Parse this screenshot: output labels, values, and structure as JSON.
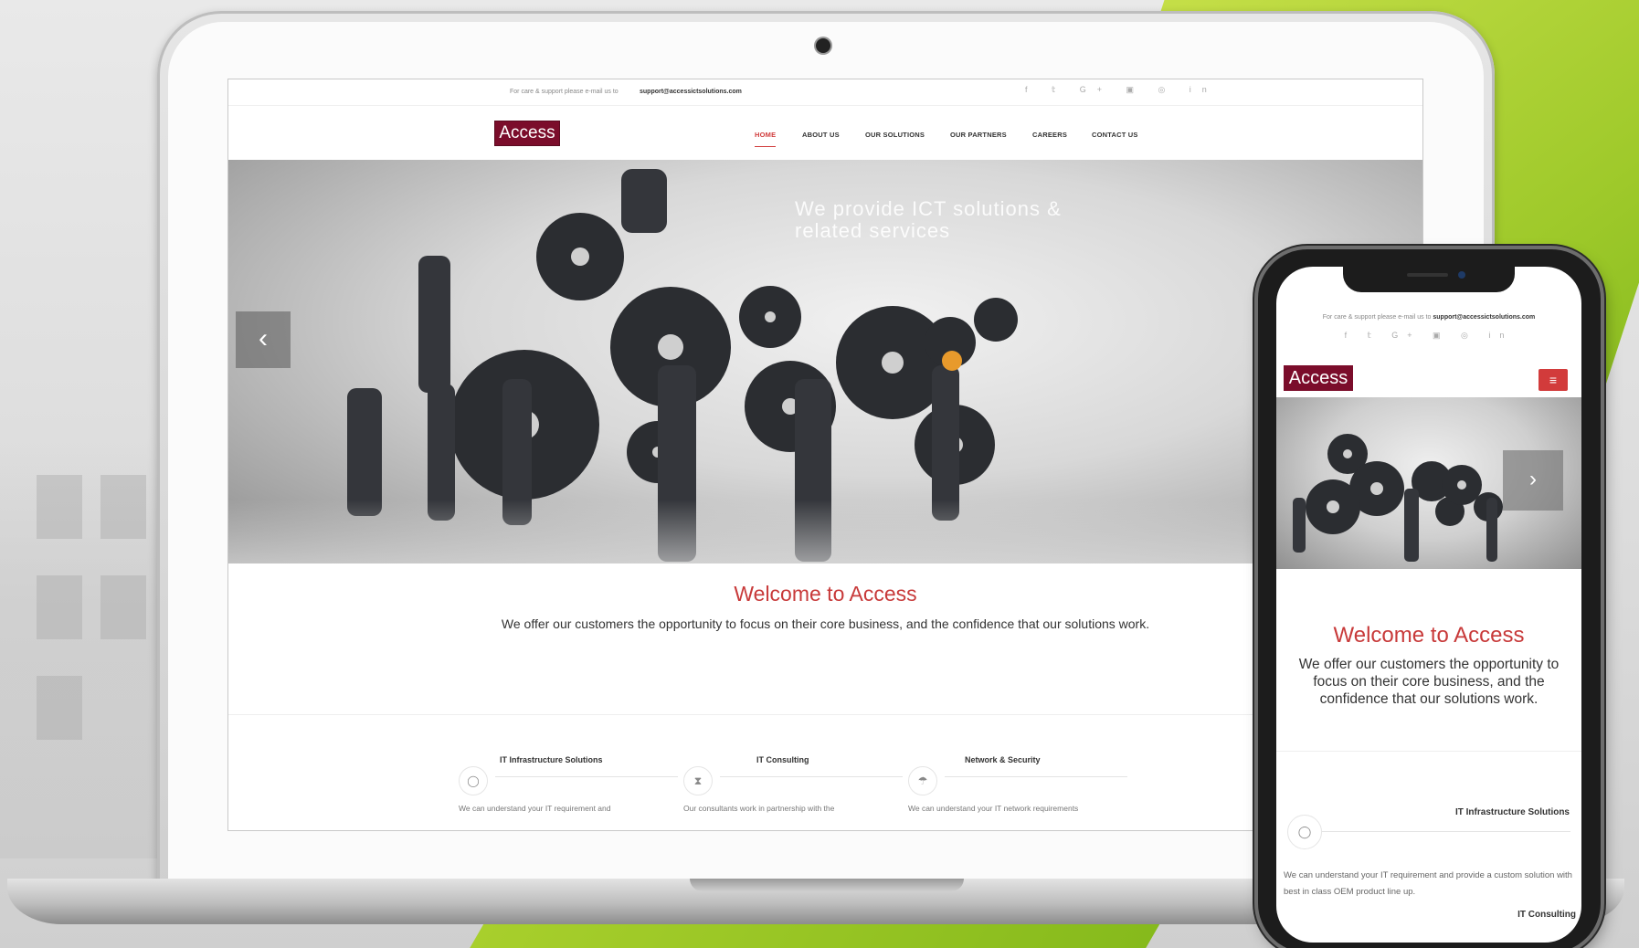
{
  "site": {
    "top_message": "For care & support please e-mail us to",
    "support_email": "support@accessictsolutions.com",
    "social_icons": [
      "facebook-icon",
      "twitter-icon",
      "google-plus-icon",
      "youtube-icon",
      "instagram-icon",
      "linkedin-icon"
    ],
    "social_glyphs": "f  𝕥  G+  ▣  ◎  in",
    "logo_text": "Access",
    "nav": [
      {
        "label": "HOME",
        "active": true
      },
      {
        "label": "ABOUT US"
      },
      {
        "label": "OUR SOLUTIONS"
      },
      {
        "label": "OUR PARTNERS"
      },
      {
        "label": "CAREERS"
      },
      {
        "label": "CONTACT US"
      }
    ],
    "hero": {
      "headline": "We provide ICT solutions & related services",
      "prev_arrow": "‹",
      "next_arrow": "›"
    },
    "welcome": {
      "title": "Welcome to Access",
      "text": "We offer our customers the opportunity to focus on their core business, and the confidence that our solutions work."
    },
    "services": [
      {
        "title": "IT Infrastructure Solutions",
        "icon": "mouse-icon",
        "glyph": "◯",
        "desc": "We can understand your IT requirement and"
      },
      {
        "title": "IT Consulting",
        "icon": "hourglass-icon",
        "glyph": "⧗",
        "desc": "Our consultants work in partnership with the"
      },
      {
        "title": "Network & Security",
        "icon": "umbrella-icon",
        "glyph": "☂",
        "desc": "We can understand your IT network requirements"
      }
    ]
  },
  "mobile": {
    "menu_glyph": "≡",
    "service_desc": "We can understand your IT requirement and provide a custom solution with best in class OEM product line up.",
    "next_service_title": "IT Consulting"
  },
  "colors": {
    "brand": "#7b0d2b",
    "accent_red": "#c83a3a",
    "background_green": "#9ec92a"
  }
}
